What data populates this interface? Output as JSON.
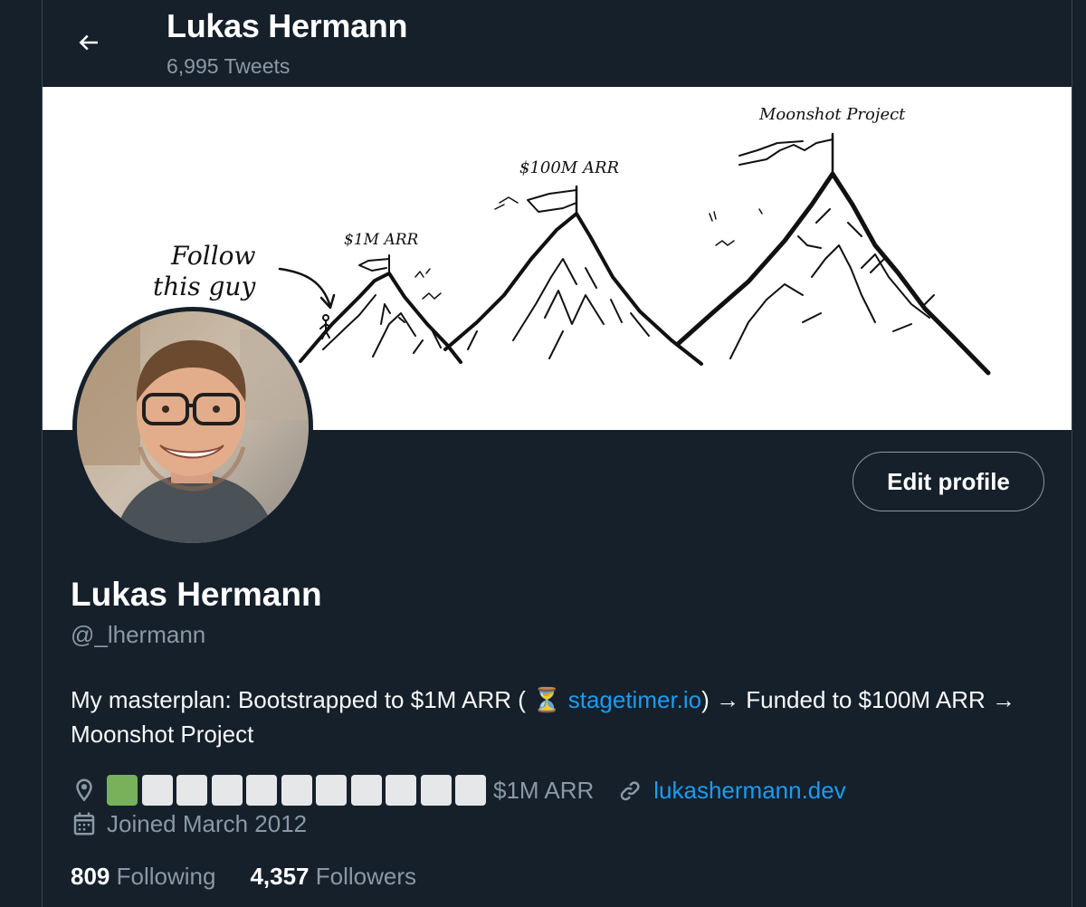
{
  "header": {
    "title": "Lukas Hermann",
    "subtitle": "6,995 Tweets"
  },
  "banner": {
    "labels": {
      "follow": [
        "Follow",
        "this guy"
      ],
      "peak1": "$1M ARR",
      "peak2": "$100M ARR",
      "peak3": "Moonshot Project"
    }
  },
  "profile": {
    "edit_label": "Edit profile",
    "name": "Lukas Hermann",
    "handle": "@_lhermann",
    "bio": {
      "before": "My masterplan: Bootstrapped to $1M ARR ( ",
      "emoji": "⏳",
      "link": "stagetimer.io",
      "after": ") → Funded to $100M ARR → Moonshot Project"
    },
    "location": {
      "icon": "location-pin-icon",
      "progress_filled": 1,
      "progress_total": 11,
      "filled_color": "#78b159",
      "empty_color": "#e6e7e9",
      "text": "$1M ARR"
    },
    "website": {
      "icon": "link-icon",
      "text": "lukashermann.dev"
    },
    "joined": {
      "icon": "calendar-icon",
      "text": "Joined March 2012"
    },
    "stats": {
      "following_count": "809",
      "following_label": "Following",
      "followers_count": "4,357",
      "followers_label": "Followers"
    }
  },
  "colors": {
    "background": "#15202b",
    "accent": "#1d9bf0",
    "secondary_text": "#8b98a5",
    "border": "#38444d"
  }
}
